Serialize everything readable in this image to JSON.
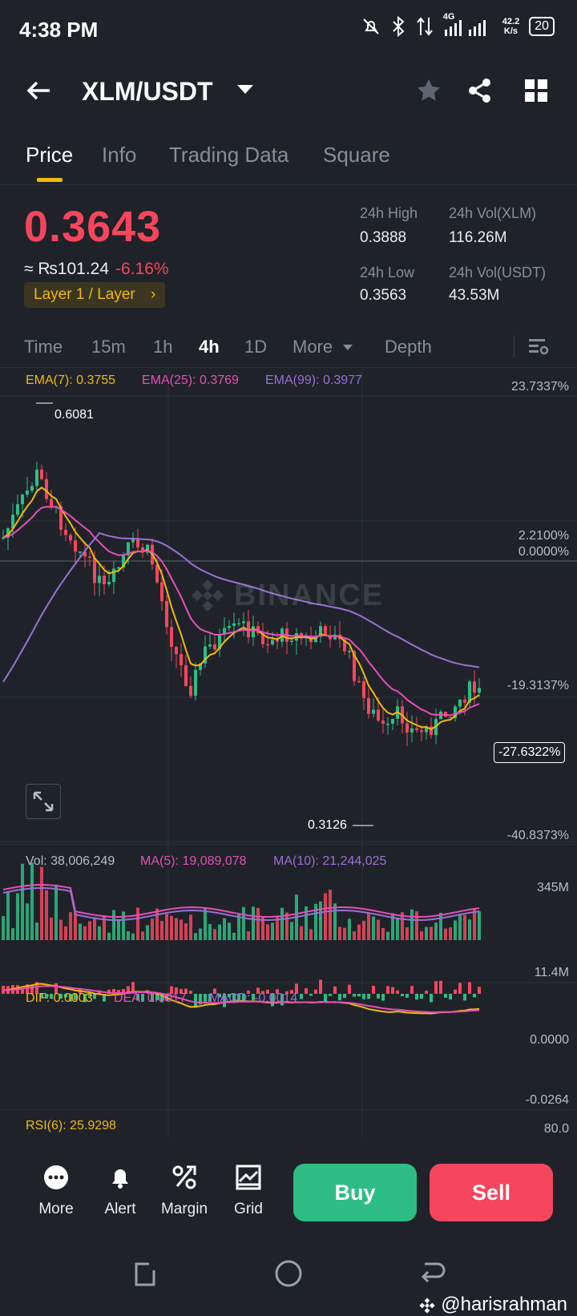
{
  "status_bar": {
    "time": "4:38 PM",
    "network": "4G",
    "speed_value": "42.2",
    "speed_unit": "K/s",
    "battery": "20"
  },
  "header": {
    "pair": "XLM/USDT"
  },
  "tabs": [
    "Price",
    "Info",
    "Trading Data",
    "Square"
  ],
  "price": {
    "last": "0.3643",
    "fiat": "≈ ₨101.24",
    "change": "-6.16%",
    "tag": "Layer 1 / Layer",
    "high_label": "24h High",
    "high": "0.3888",
    "low_label": "24h Low",
    "low": "0.3563",
    "vol_xlm_label": "24h Vol(XLM)",
    "vol_xlm": "116.26M",
    "vol_usdt_label": "24h Vol(USDT)",
    "vol_usdt": "43.53M"
  },
  "intervals": [
    "Time",
    "15m",
    "1h",
    "4h",
    "1D",
    "More",
    "Depth"
  ],
  "active_interval": "4h",
  "chart": {
    "ema7": "EMA(7): 0.3755",
    "ema25": "EMA(25): 0.3769",
    "ema99": "EMA(99): 0.3977",
    "axis_top": "23.7337%",
    "axis_a": "2.2100%",
    "axis_b": "0.0000%",
    "axis_c": "-19.3137%",
    "axis_current": "-27.6322%",
    "axis_bottom": "-40.8373%",
    "max_label": "0.6081",
    "min_label": "0.3126",
    "watermark": "BINANCE",
    "vol": "Vol: 38,006,249",
    "ma5": "MA(5): 19,089,078",
    "ma10": "MA(10): 21,244,025",
    "vol_top": "345M",
    "vol_bottom": "11.4M",
    "dif": "DIF: 0.0003",
    "dea": "DEA: 0.0017",
    "macd": "MACD: -0.0014",
    "macd_top": "0.0000",
    "macd_bottom": "-0.0264",
    "rsi": "RSI(6): 25.9298",
    "rsi_top": "80.0",
    "colors": {
      "up": "#2ebd85",
      "down": "#f6465d",
      "ema7": "#f0b90b",
      "ema25": "#e64fb8",
      "ema99": "#9b6fd6"
    }
  },
  "bottom_bar": {
    "more": "More",
    "alert": "Alert",
    "margin": "Margin",
    "grid": "Grid",
    "buy": "Buy",
    "sell": "Sell"
  },
  "watermark": "@harisrahman"
}
